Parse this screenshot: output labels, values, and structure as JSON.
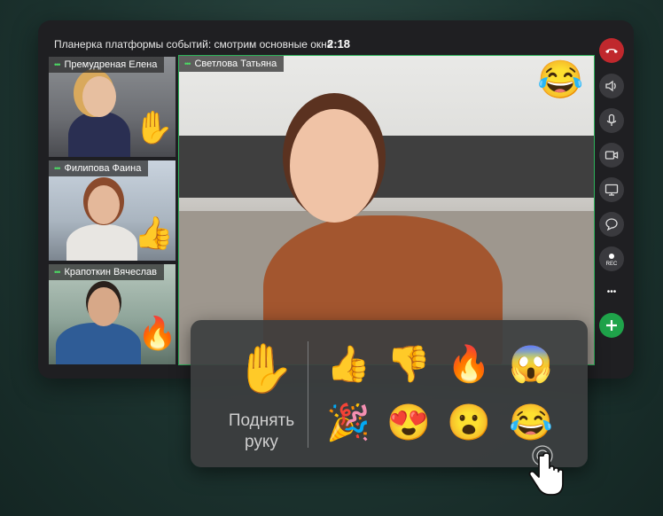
{
  "meeting": {
    "title": "Планерка платформы событий: смотрим основные окна",
    "timer": "2:18"
  },
  "participants": [
    {
      "name": "Премудреная Елена",
      "reaction": "✋"
    },
    {
      "name": "Филипова Фаина",
      "reaction": "👍"
    },
    {
      "name": "Крапоткин Вячеслав",
      "reaction": "🔥"
    }
  ],
  "speaker": {
    "name": "Светлова Татьяна",
    "reaction": "😂"
  },
  "sidebar": {
    "rec_label": "REC",
    "more_label": "•••",
    "icons": [
      "hangup-icon",
      "speaker-icon",
      "microphone-icon",
      "camera-icon",
      "screen-share-icon",
      "chat-icon",
      "record-icon",
      "more-icon",
      "add-icon"
    ]
  },
  "reaction_panel": {
    "raise_hand_emoji": "✋",
    "raise_hand_label": "Поднять\nруку",
    "emojis": [
      "👍",
      "👎",
      "🔥",
      "😱",
      "🎉",
      "😍",
      "😮",
      "😂"
    ]
  },
  "colors": {
    "hangup": "#c0282d",
    "add": "#1fa34a",
    "active_dots": "#4cd964"
  }
}
